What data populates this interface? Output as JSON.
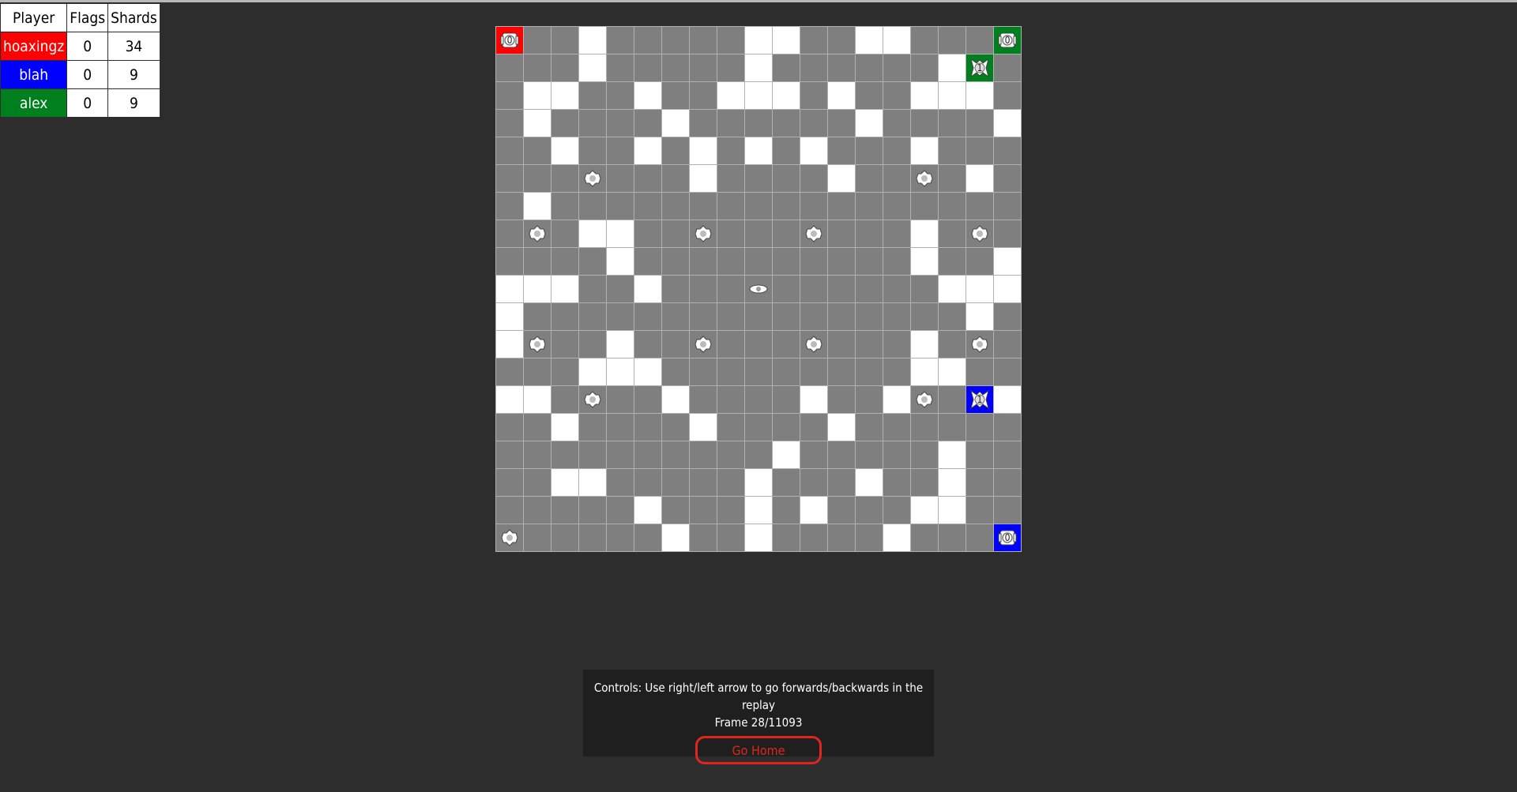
{
  "scoreboard": {
    "headers": [
      "Player",
      "Flags",
      "Shards"
    ],
    "players": [
      {
        "name": "hoaxingz",
        "flags": "0",
        "shards": "34",
        "color": "#ff0000"
      },
      {
        "name": "blah",
        "flags": "0",
        "shards": "9",
        "color": "#0000ff"
      },
      {
        "name": "alex",
        "flags": "0",
        "shards": "9",
        "color": "#007f1f"
      }
    ]
  },
  "board": {
    "size": 19,
    "colors": {
      "empty": "#7f7f7f",
      "mountain": "#ffffff",
      "grid": "#b0b0b0",
      "red": "#ff0000",
      "blue": "#0000ff",
      "green": "#007f1f"
    },
    "mountains": [
      [
        0,
        3
      ],
      [
        0,
        9
      ],
      [
        0,
        10
      ],
      [
        0,
        13
      ],
      [
        0,
        14
      ],
      [
        1,
        3
      ],
      [
        1,
        9
      ],
      [
        1,
        16
      ],
      [
        2,
        1
      ],
      [
        2,
        2
      ],
      [
        2,
        5
      ],
      [
        2,
        8
      ],
      [
        2,
        9
      ],
      [
        2,
        10
      ],
      [
        2,
        12
      ],
      [
        2,
        15
      ],
      [
        2,
        16
      ],
      [
        2,
        17
      ],
      [
        3,
        1
      ],
      [
        3,
        6
      ],
      [
        3,
        13
      ],
      [
        3,
        18
      ],
      [
        4,
        2
      ],
      [
        4,
        5
      ],
      [
        4,
        7
      ],
      [
        4,
        9
      ],
      [
        4,
        11
      ],
      [
        4,
        15
      ],
      [
        5,
        7
      ],
      [
        5,
        12
      ],
      [
        5,
        17
      ],
      [
        6,
        1
      ],
      [
        7,
        3
      ],
      [
        7,
        4
      ],
      [
        7,
        15
      ],
      [
        8,
        4
      ],
      [
        8,
        15
      ],
      [
        8,
        18
      ],
      [
        9,
        0
      ],
      [
        9,
        1
      ],
      [
        9,
        2
      ],
      [
        9,
        5
      ],
      [
        9,
        16
      ],
      [
        9,
        17
      ],
      [
        9,
        18
      ],
      [
        10,
        0
      ],
      [
        10,
        17
      ],
      [
        11,
        0
      ],
      [
        11,
        4
      ],
      [
        11,
        15
      ],
      [
        12,
        3
      ],
      [
        12,
        4
      ],
      [
        12,
        5
      ],
      [
        12,
        15
      ],
      [
        12,
        16
      ],
      [
        13,
        0
      ],
      [
        13,
        1
      ],
      [
        13,
        6
      ],
      [
        13,
        11
      ],
      [
        13,
        14
      ],
      [
        13,
        18
      ],
      [
        14,
        2
      ],
      [
        14,
        7
      ],
      [
        14,
        12
      ],
      [
        15,
        10
      ],
      [
        15,
        16
      ],
      [
        16,
        2
      ],
      [
        16,
        3
      ],
      [
        16,
        9
      ],
      [
        16,
        13
      ],
      [
        16,
        16
      ],
      [
        17,
        5
      ],
      [
        17,
        9
      ],
      [
        17,
        11
      ],
      [
        17,
        15
      ],
      [
        17,
        16
      ],
      [
        18,
        6
      ],
      [
        18,
        9
      ],
      [
        18,
        14
      ]
    ],
    "special": [
      {
        "r": 0,
        "c": 0,
        "type": "core",
        "owner": "red",
        "count": "0"
      },
      {
        "r": 0,
        "c": 18,
        "type": "core",
        "owner": "green",
        "count": "0"
      },
      {
        "r": 18,
        "c": 18,
        "type": "core",
        "owner": "blue",
        "count": "0"
      },
      {
        "r": 1,
        "c": 17,
        "type": "flag",
        "owner": "green",
        "count": "1"
      },
      {
        "r": 13,
        "c": 17,
        "type": "flag",
        "owner": "blue",
        "count": "1"
      },
      {
        "r": 9,
        "c": 9,
        "type": "center",
        "owner": null,
        "count": ""
      },
      {
        "r": 5,
        "c": 3,
        "type": "shard",
        "owner": null,
        "count": ""
      },
      {
        "r": 5,
        "c": 15,
        "type": "shard",
        "owner": null,
        "count": ""
      },
      {
        "r": 7,
        "c": 1,
        "type": "shard",
        "owner": null,
        "count": ""
      },
      {
        "r": 7,
        "c": 7,
        "type": "shard",
        "owner": null,
        "count": ""
      },
      {
        "r": 7,
        "c": 11,
        "type": "shard",
        "owner": null,
        "count": ""
      },
      {
        "r": 7,
        "c": 17,
        "type": "shard",
        "owner": null,
        "count": ""
      },
      {
        "r": 11,
        "c": 1,
        "type": "shard",
        "owner": null,
        "count": ""
      },
      {
        "r": 11,
        "c": 7,
        "type": "shard",
        "owner": null,
        "count": ""
      },
      {
        "r": 11,
        "c": 11,
        "type": "shard",
        "owner": null,
        "count": ""
      },
      {
        "r": 11,
        "c": 17,
        "type": "shard",
        "owner": null,
        "count": ""
      },
      {
        "r": 13,
        "c": 3,
        "type": "shard",
        "owner": null,
        "count": ""
      },
      {
        "r": 13,
        "c": 15,
        "type": "shard",
        "owner": null,
        "count": ""
      },
      {
        "r": 18,
        "c": 0,
        "type": "shard",
        "owner": null,
        "count": ""
      }
    ]
  },
  "controls": {
    "instructions": "Controls: Use right/left arrow to go forwards/backwards in the replay",
    "frame": "Frame 28/11093",
    "go_home_label": "Go Home"
  }
}
